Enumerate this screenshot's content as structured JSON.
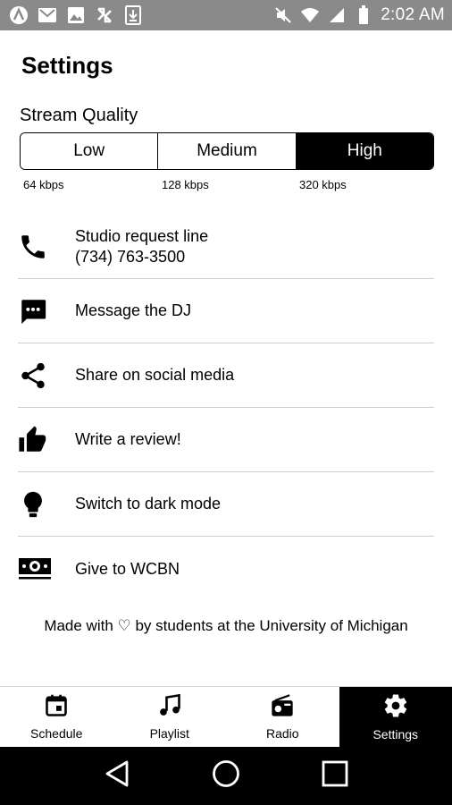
{
  "status_bar": {
    "time": "2:02 AM",
    "left_icons": [
      "app-icon",
      "gmail-icon",
      "image-icon",
      "sync-icon",
      "download-icon"
    ],
    "right_icons": [
      "mute-icon",
      "wifi-icon",
      "signal-icon",
      "battery-icon"
    ]
  },
  "page": {
    "title": "Settings"
  },
  "stream_quality": {
    "label": "Stream Quality",
    "options": [
      {
        "label": "Low",
        "bitrate": "64 kbps"
      },
      {
        "label": "Medium",
        "bitrate": "128 kbps"
      },
      {
        "label": "High",
        "bitrate": "320 kbps"
      }
    ],
    "selected": "High"
  },
  "items": [
    {
      "icon": "phone-icon",
      "line1": "Studio request line",
      "line2": "(734) 763-3500"
    },
    {
      "icon": "message-icon",
      "line1": "Message the DJ"
    },
    {
      "icon": "share-icon",
      "line1": "Share on social media"
    },
    {
      "icon": "thumbs-up-icon",
      "line1": "Write a review!"
    },
    {
      "icon": "lightbulb-icon",
      "line1": "Switch to dark mode"
    },
    {
      "icon": "money-icon",
      "line1": "Give to WCBN"
    }
  ],
  "footer_note": "Made with ♡ by students at the University of Michigan",
  "tabs": [
    {
      "label": "Schedule",
      "icon": "calendar-icon"
    },
    {
      "label": "Playlist",
      "icon": "music-note-icon"
    },
    {
      "label": "Radio",
      "icon": "radio-icon"
    },
    {
      "label": "Settings",
      "icon": "gear-icon",
      "active": true
    }
  ],
  "nav": [
    "back-icon",
    "home-icon",
    "recents-icon"
  ]
}
